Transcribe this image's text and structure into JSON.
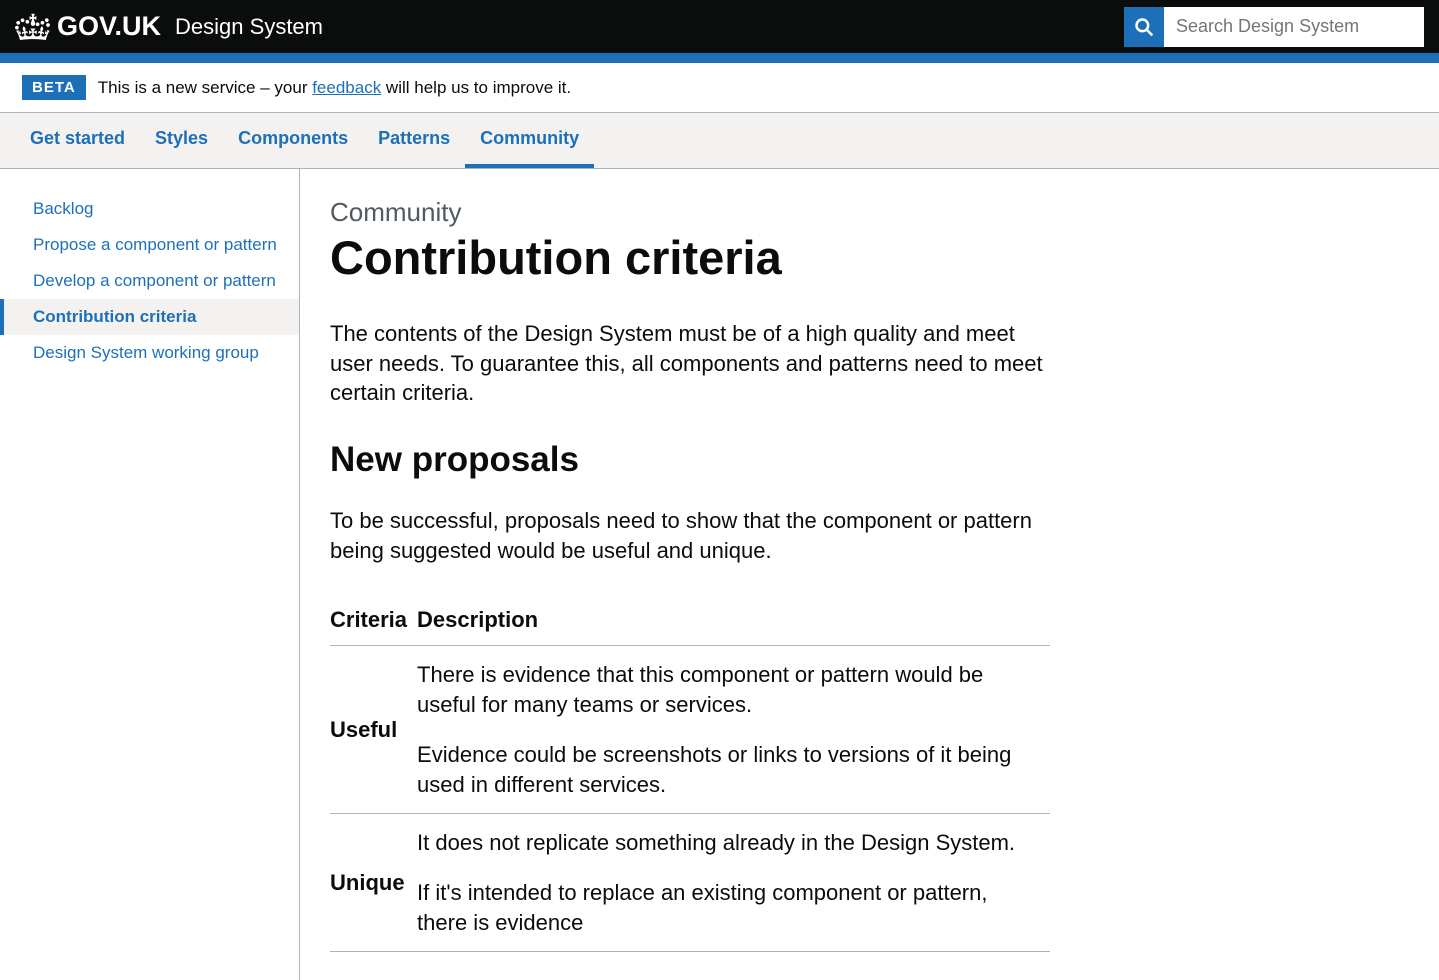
{
  "header": {
    "govuk": "GOV.UK",
    "product": "Design System"
  },
  "search": {
    "placeholder": "Search Design System"
  },
  "phase": {
    "tag": "BETA",
    "text_before": "This is a new service – your ",
    "link": "feedback",
    "text_after": " will help us to improve it."
  },
  "nav": {
    "items": [
      "Get started",
      "Styles",
      "Components",
      "Patterns",
      "Community"
    ],
    "active_index": 4
  },
  "sidebar": {
    "items": [
      "Backlog",
      "Propose a component or pattern",
      "Develop a component or pattern",
      "Contribution criteria",
      "Design System working group"
    ],
    "active_index": 3
  },
  "main": {
    "caption": "Community",
    "title": "Contribution criteria",
    "intro": "The contents of the Design System must be of a high quality and meet user needs. To guarantee this, all components and patterns need to meet certain criteria.",
    "section_heading": "New proposals",
    "section_intro": "To be successful, proposals need to show that the component or pattern being suggested would be useful and unique.",
    "table": {
      "headers": [
        "Criteria",
        "Description"
      ],
      "rows": [
        {
          "criteria": "Useful",
          "paragraphs": [
            "There is evidence that this component or pattern would be useful for many teams or services.",
            "Evidence could be screenshots or links to versions of it being used in different services."
          ]
        },
        {
          "criteria": "Unique",
          "paragraphs": [
            "It does not replicate something already in the Design System.",
            "If it's intended to replace an existing component or pattern, there is evidence"
          ]
        }
      ]
    }
  }
}
